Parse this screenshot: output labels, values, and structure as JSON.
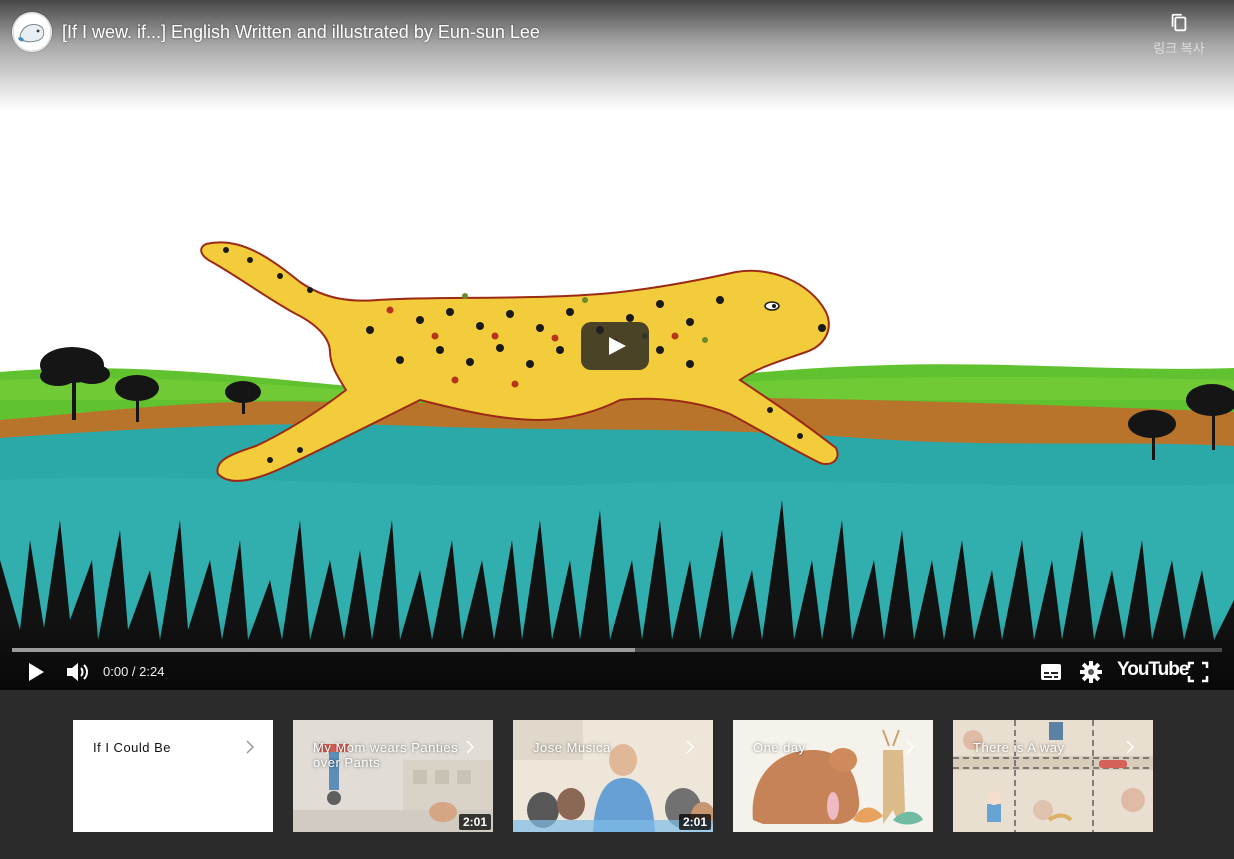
{
  "video": {
    "title": "[If I wew. if...] English Written and illustrated by Eun-sun Lee",
    "copy_link_label": "링크 복사",
    "time_display": "0:00 / 2:24",
    "buffered_fraction": 0.515,
    "brand": "YouTube"
  },
  "end_cards": [
    {
      "title": "If I Could Be",
      "duration": ""
    },
    {
      "title": "My Mom wears Panties over Pants",
      "duration": "2:01"
    },
    {
      "title": "Jose Musica",
      "duration": "2:01"
    },
    {
      "title": "One day",
      "duration": ""
    },
    {
      "title": "There is A way",
      "duration": ""
    }
  ],
  "icons": {
    "channel": "whale-avatar-icon",
    "copy": "copy-icon",
    "play": "play-icon",
    "volume": "volume-icon",
    "subtitles": "subtitles-icon",
    "settings": "gear-icon",
    "fullscreen": "fullscreen-icon",
    "chevron": "chevron-right-icon"
  },
  "colors": {
    "sky": "#ffffff",
    "grass": "#5fc22e",
    "earth": "#b9742c",
    "water": "#2aa9a8",
    "cheetah": "#f2cc3a",
    "panel_bg": "#2b2b2b"
  }
}
